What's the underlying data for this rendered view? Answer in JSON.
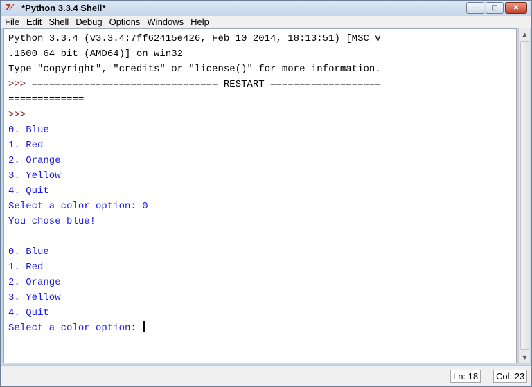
{
  "window": {
    "title": "*Python 3.3.4 Shell*",
    "icon_glyph": "7⁄",
    "controls": {
      "minimize": "—",
      "maximize": "□",
      "close": "✖"
    }
  },
  "menu": [
    "File",
    "Edit",
    "Shell",
    "Debug",
    "Options",
    "Windows",
    "Help"
  ],
  "editor": {
    "lines": [
      {
        "kind": "normal",
        "text": "Python 3.3.4 (v3.3.4:7ff62415e426, Feb 10 2014, 18:13:51) [MSC v"
      },
      {
        "kind": "normal",
        "text": ".1600 64 bit (AMD64)] on win32"
      },
      {
        "kind": "normal",
        "text": "Type \"copyright\", \"credits\" or \"license()\" for more information."
      },
      {
        "kind": "prompt",
        "prompt": ">>> ",
        "text": "================================ RESTART ==================="
      },
      {
        "kind": "normal",
        "text": "============="
      },
      {
        "kind": "prompt",
        "prompt": ">>>",
        "text": ""
      },
      {
        "kind": "output",
        "text": "0. Blue"
      },
      {
        "kind": "output",
        "text": "1. Red"
      },
      {
        "kind": "output",
        "text": "2. Orange"
      },
      {
        "kind": "output",
        "text": "3. Yellow"
      },
      {
        "kind": "output",
        "text": "4. Quit"
      },
      {
        "kind": "output",
        "text": "Select a color option: 0"
      },
      {
        "kind": "output",
        "text": "You chose blue!"
      },
      {
        "kind": "output",
        "text": ""
      },
      {
        "kind": "output",
        "text": "0. Blue"
      },
      {
        "kind": "output",
        "text": "1. Red"
      },
      {
        "kind": "output",
        "text": "2. Orange"
      },
      {
        "kind": "output",
        "text": "3. Yellow"
      },
      {
        "kind": "output",
        "text": "4. Quit"
      },
      {
        "kind": "output",
        "text": "Select a color option: "
      }
    ]
  },
  "status": {
    "line": "Ln: 18",
    "col": "Col: 23"
  },
  "colors": {
    "output_text": "#1a1ae6",
    "prompt_text": "#8b1a1a",
    "close_button": "#c2442a"
  },
  "icons": {
    "window": "idle-icon",
    "scroll_up": "scroll-up-arrow-icon",
    "scroll_down": "scroll-down-arrow-icon"
  }
}
